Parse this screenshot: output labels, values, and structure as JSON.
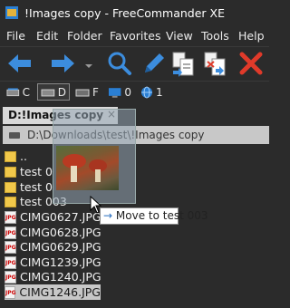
{
  "window": {
    "title": "!Images copy - FreeCommander XE"
  },
  "menu": [
    "File",
    "Edit",
    "Folder",
    "Favorites",
    "View",
    "Tools",
    "Help"
  ],
  "toolbar": {
    "buttons": [
      "back-arrow-icon",
      "forward-arrow-icon",
      "search-icon",
      "edit-pencil-icon",
      "copy-files-icon",
      "move-files-icon",
      "delete-x-icon"
    ]
  },
  "drives": [
    {
      "label": "C",
      "icon": "hard-drive-icon",
      "selected": false
    },
    {
      "label": "D",
      "icon": "hard-drive-icon",
      "selected": true
    },
    {
      "label": "F",
      "icon": "drive-icon",
      "selected": false
    },
    {
      "label": "0",
      "icon": "monitor-icon",
      "selected": false
    },
    {
      "label": "1",
      "icon": "network-globe-icon",
      "selected": false
    }
  ],
  "panel": {
    "tab_label": "D:!Images copy",
    "tab_close": "×",
    "path": "D:\\Downloads\\test\\!Images copy",
    "rows": [
      {
        "name": "..",
        "type": "folder",
        "selected": false
      },
      {
        "name": "test 0",
        "type": "folder",
        "selected": false
      },
      {
        "name": "test 0",
        "type": "folder",
        "selected": false
      },
      {
        "name": "test 003",
        "type": "folder",
        "selected": false
      },
      {
        "name": "CIMG0627.JPG",
        "type": "jpg",
        "selected": false
      },
      {
        "name": "CIMG0628.JPG",
        "type": "jpg",
        "selected": false
      },
      {
        "name": "CIMG0629.JPG",
        "type": "jpg",
        "selected": false
      },
      {
        "name": "CIMG1239.JPG",
        "type": "jpg",
        "selected": false
      },
      {
        "name": "CIMG1240.JPG",
        "type": "jpg",
        "selected": false
      },
      {
        "name": "CIMG1246.JPG",
        "type": "jpg",
        "selected": true
      }
    ],
    "jpg_badge": "JPG"
  },
  "drag": {
    "tooltip": "Move to test 003",
    "tooltip_arrow": "→"
  },
  "colors": {
    "accent_blue": "#3c8dde",
    "delete_red": "#e03a2a",
    "folder_yellow": "#f1c84a"
  }
}
